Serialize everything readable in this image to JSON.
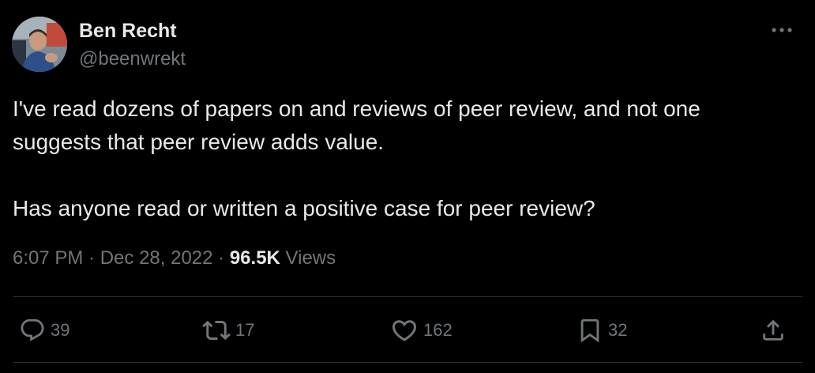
{
  "author": {
    "display_name": "Ben Recht",
    "handle": "@beenwrekt",
    "avatar_icon": "profile-photo"
  },
  "tweet": {
    "lines": [
      "I've read dozens of papers on and reviews of peer review, and not one",
      "suggests that peer review adds value.",
      "",
      "Has anyone read or written a positive case for peer review?"
    ],
    "time": "6:07 PM",
    "separator": " · ",
    "date": "Dec 28, 2022",
    "views_count": "96.5K",
    "views_label": "Views"
  },
  "actions": {
    "reply": {
      "icon": "reply-icon",
      "count": "39"
    },
    "retweet": {
      "icon": "retweet-icon",
      "count": "17"
    },
    "like": {
      "icon": "heart-icon",
      "count": "162"
    },
    "bookmark": {
      "icon": "bookmark-icon",
      "count": "32"
    },
    "share": {
      "icon": "share-icon"
    }
  },
  "colors": {
    "background": "#000000",
    "primary_text": "#e7e9ea",
    "secondary_text": "#71767b",
    "divider": "#2f3336"
  }
}
